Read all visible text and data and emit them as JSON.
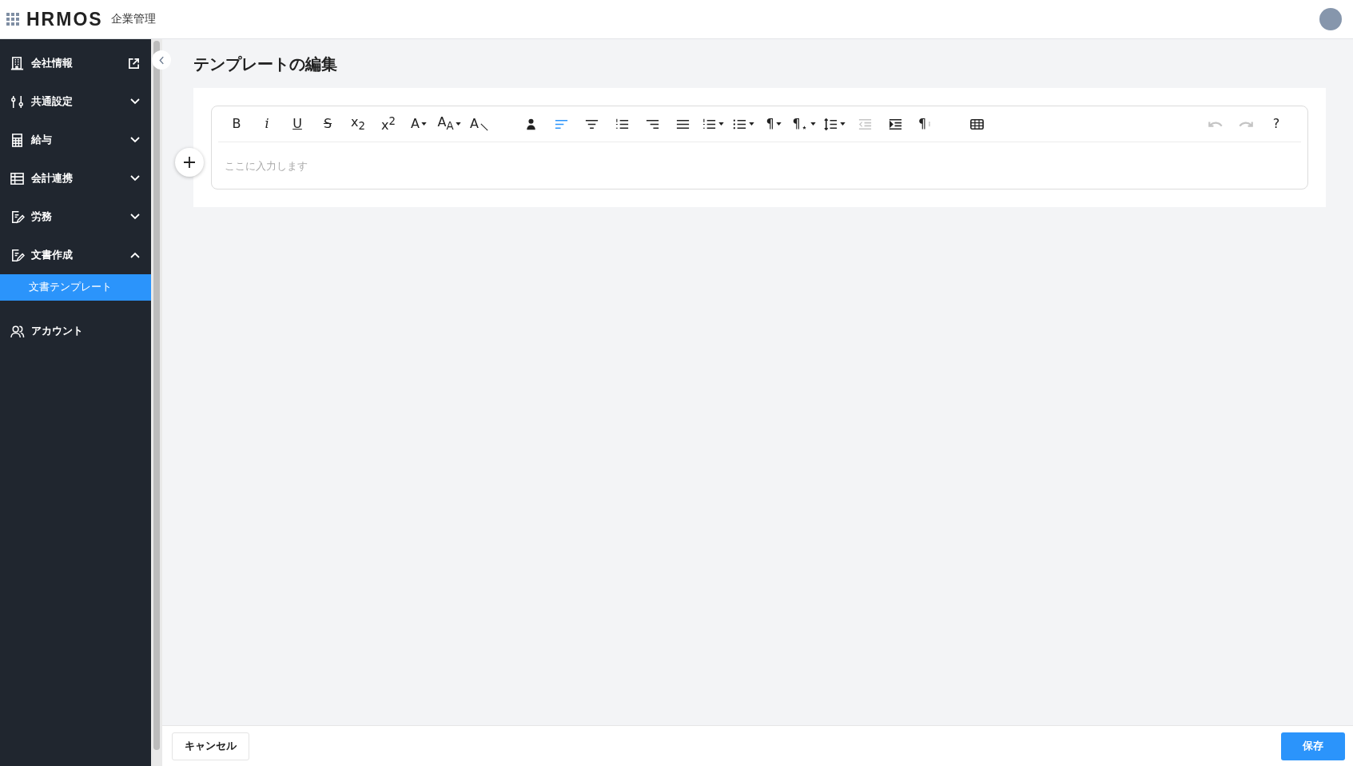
{
  "header": {
    "logo": "HRMOS",
    "product": "企業管理"
  },
  "sidebar": {
    "items": [
      {
        "label": "会社情報",
        "kind": "link"
      },
      {
        "label": "共通設定",
        "kind": "group",
        "expanded": false
      },
      {
        "label": "給与",
        "kind": "group",
        "expanded": false
      },
      {
        "label": "会計連携",
        "kind": "group",
        "expanded": false
      },
      {
        "label": "労務",
        "kind": "group",
        "expanded": false
      },
      {
        "label": "文書作成",
        "kind": "group",
        "expanded": true,
        "children": [
          {
            "label": "文書テンプレート",
            "selected": true
          }
        ]
      },
      {
        "label": "アカウント",
        "kind": "plain"
      }
    ]
  },
  "page": {
    "title": "テンプレートの編集"
  },
  "editor": {
    "placeholder": "ここに入力します",
    "toolbar": {
      "format": [
        {
          "kind": "bold",
          "label": "B",
          "active": false,
          "disabled": false
        },
        {
          "kind": "italic",
          "label": "i",
          "active": false,
          "disabled": false
        },
        {
          "kind": "underline",
          "label": "U",
          "active": false,
          "disabled": false
        },
        {
          "kind": "strike",
          "label": "S",
          "active": false,
          "disabled": false
        },
        {
          "kind": "subscript",
          "label": "x$_{2}$",
          "active": false,
          "disabled": false
        },
        {
          "kind": "superscript",
          "label": "x$^{2}$",
          "active": false,
          "disabled": false
        },
        {
          "kind": "font-color",
          "label": "A",
          "dropdown": true,
          "active": false,
          "disabled": false
        },
        {
          "kind": "font-size",
          "label": "A$_{A}$",
          "dropdown": true,
          "active": false,
          "disabled": false
        },
        {
          "kind": "clear-format",
          "label": "A",
          "active": false,
          "disabled": false
        }
      ],
      "paragraph": [
        {
          "kind": "person",
          "active": false,
          "disabled": false
        },
        {
          "kind": "align-left",
          "active": true,
          "disabled": false
        },
        {
          "kind": "align-center",
          "active": false,
          "disabled": false
        },
        {
          "kind": "numbered-list",
          "active": false,
          "disabled": false
        },
        {
          "kind": "align-right",
          "active": false,
          "disabled": false
        },
        {
          "kind": "justify",
          "active": false,
          "disabled": false
        },
        {
          "kind": "ordered-list",
          "dropdown": true,
          "active": false,
          "disabled": false
        },
        {
          "kind": "bullet-list",
          "dropdown": true,
          "active": false,
          "disabled": false
        },
        {
          "kind": "paragraph",
          "label": "¶",
          "dropdown": true,
          "active": false,
          "disabled": false
        },
        {
          "kind": "paragraph-style",
          "label": "¶",
          "dropdown": true,
          "active": false,
          "disabled": false
        },
        {
          "kind": "line-height",
          "dropdown": true,
          "active": false,
          "disabled": false
        },
        {
          "kind": "outdent",
          "active": false,
          "disabled": true
        },
        {
          "kind": "indent",
          "active": false,
          "disabled": false
        },
        {
          "kind": "paragraph-marks",
          "label": "¶",
          "active": false,
          "disabled": false
        }
      ],
      "insert": [
        {
          "kind": "table",
          "active": false,
          "disabled": false
        }
      ],
      "history": [
        {
          "kind": "undo",
          "active": false,
          "disabled": true
        },
        {
          "kind": "redo",
          "active": false,
          "disabled": true
        },
        {
          "kind": "help",
          "label": "?",
          "active": false,
          "disabled": false
        }
      ]
    }
  },
  "footer": {
    "cancel": "キャンセル",
    "save": "保存"
  }
}
